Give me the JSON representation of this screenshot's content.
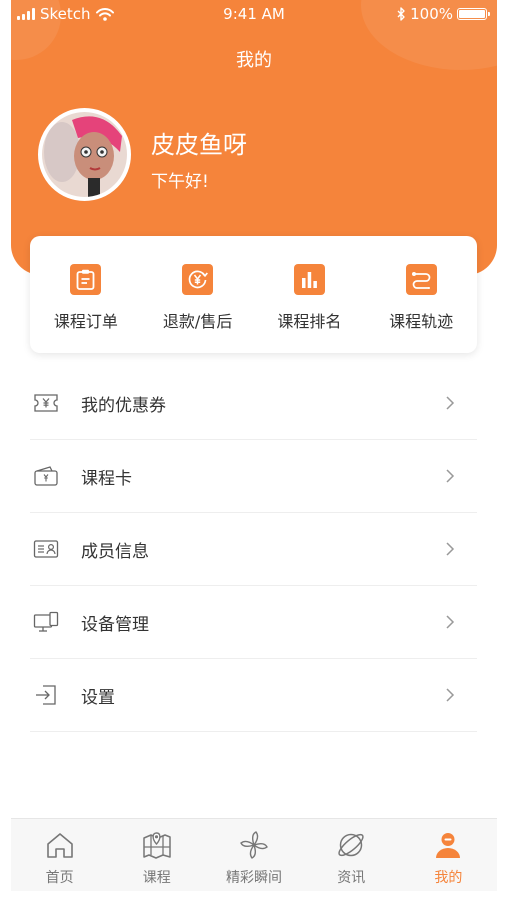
{
  "status_bar": {
    "carrier": "Sketch",
    "time": "9:41 AM",
    "battery": "100%"
  },
  "header": {
    "title": "我的",
    "user_name": "皮皮鱼呀",
    "greeting": "下午好!"
  },
  "quick_actions": [
    {
      "label": "课程订单",
      "icon": "order-icon"
    },
    {
      "label": "退款/售后",
      "icon": "yen-refund-icon"
    },
    {
      "label": "课程排名",
      "icon": "bar-chart-icon"
    },
    {
      "label": "课程轨迹",
      "icon": "route-icon"
    }
  ],
  "menu": [
    {
      "label": "我的优惠券",
      "icon": "coupon-icon"
    },
    {
      "label": "课程卡",
      "icon": "wallet-card-icon"
    },
    {
      "label": "成员信息",
      "icon": "id-card-icon"
    },
    {
      "label": "设备管理",
      "icon": "devices-icon"
    },
    {
      "label": "设置",
      "icon": "logout-icon"
    }
  ],
  "tabbar": {
    "active_index": 4,
    "items": [
      {
        "label": "首页",
        "icon": "home-icon"
      },
      {
        "label": "课程",
        "icon": "map-icon"
      },
      {
        "label": "精彩瞬间",
        "icon": "pinwheel-icon"
      },
      {
        "label": "资讯",
        "icon": "planet-icon"
      },
      {
        "label": "我的",
        "icon": "user-icon"
      }
    ]
  },
  "colors": {
    "accent": "#f5843b",
    "text": "#333333",
    "muted": "#777777"
  }
}
